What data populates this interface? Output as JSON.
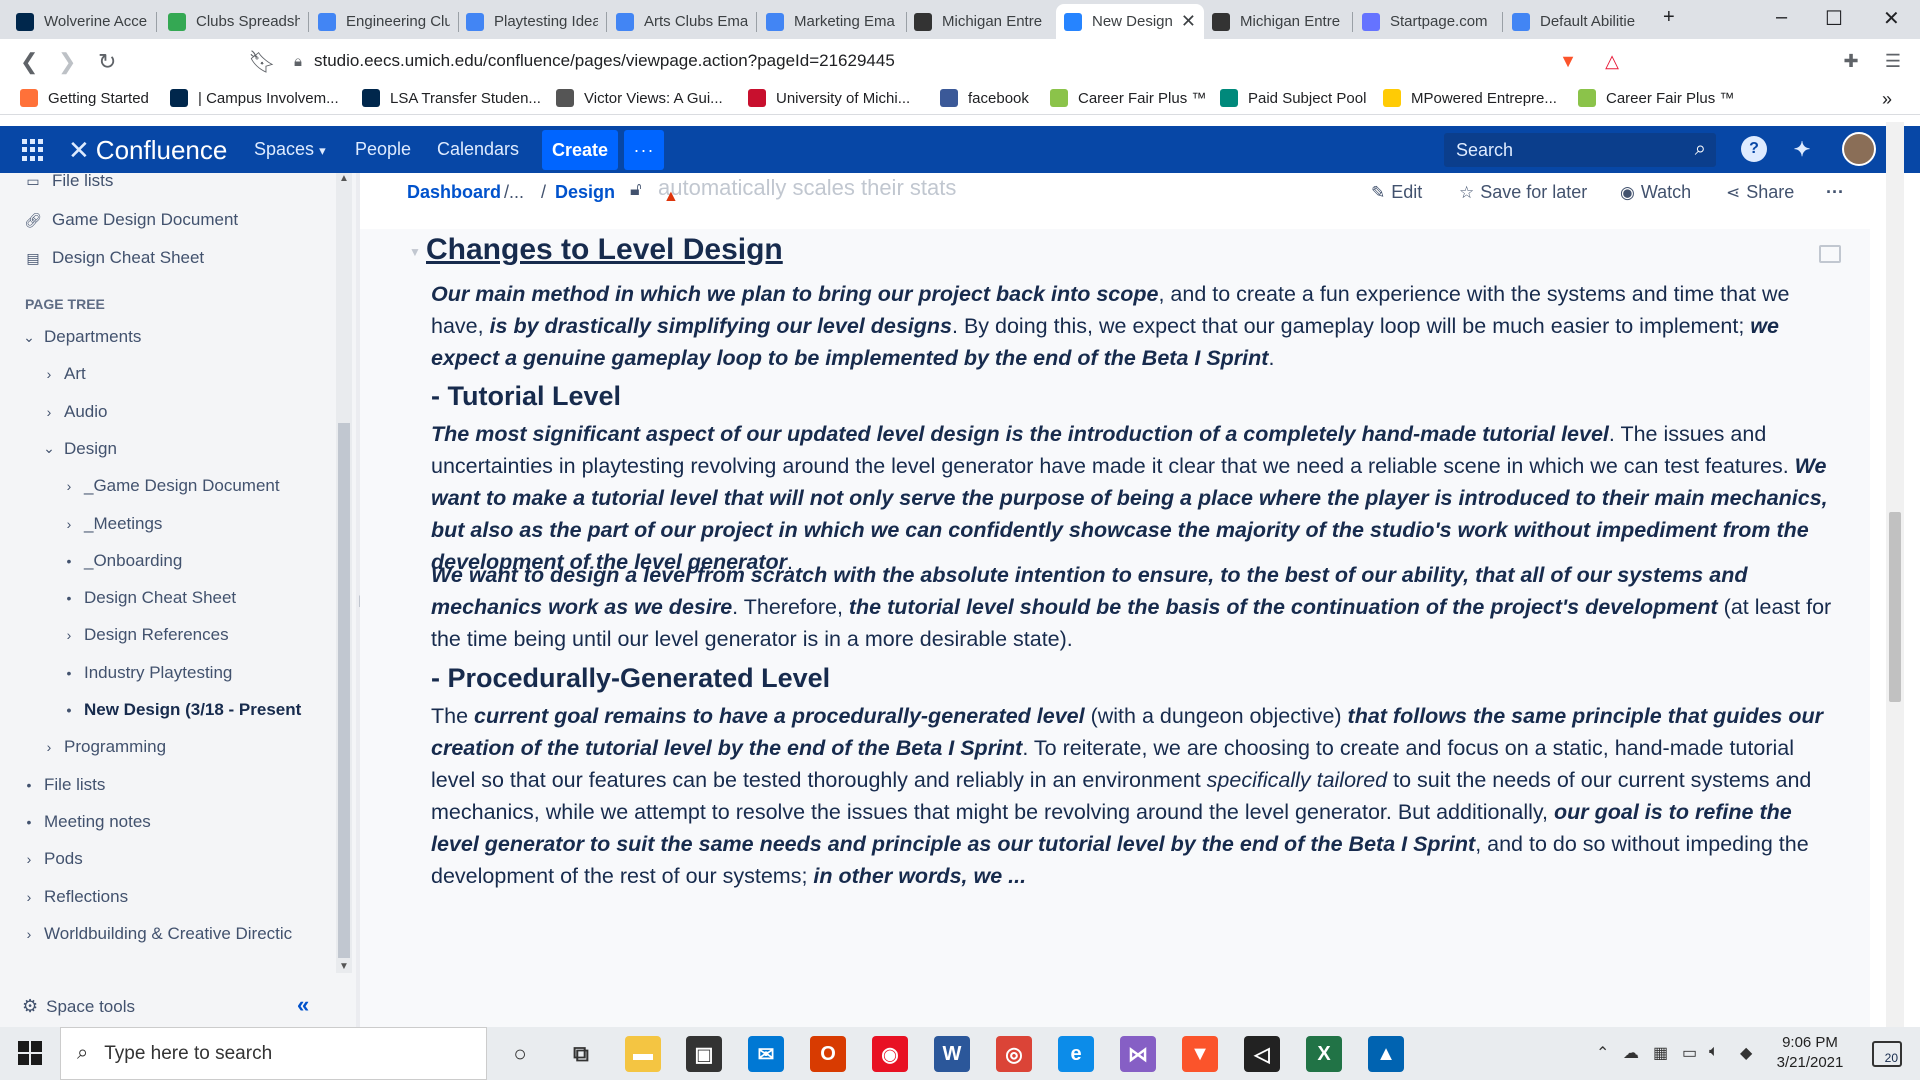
{
  "browser": {
    "tabs": [
      {
        "label": "Wolverine Acce",
        "icon": "michigan-m-icon",
        "color": "#00274c"
      },
      {
        "label": "Clubs Spreadsh",
        "icon": "google-drive-icon",
        "color": "#34a853"
      },
      {
        "label": "Engineering Clu",
        "icon": "google-docs-icon",
        "color": "#4285f4"
      },
      {
        "label": "Playtesting Idea",
        "icon": "google-docs-icon",
        "color": "#4285f4"
      },
      {
        "label": "Arts Clubs Ema",
        "icon": "google-docs-icon",
        "color": "#4285f4"
      },
      {
        "label": "Marketing Ema",
        "icon": "google-docs-icon",
        "color": "#4285f4"
      },
      {
        "label": "Michigan Entre",
        "icon": "mes-icon",
        "color": "#333333"
      },
      {
        "label": "New Design",
        "icon": "confluence-icon",
        "color": "#2684ff"
      },
      {
        "label": "Michigan Entre",
        "icon": "mes-icon",
        "color": "#333333"
      },
      {
        "label": "Startpage.com",
        "icon": "startpage-icon",
        "color": "#6573ff"
      },
      {
        "label": "Default Abilitie",
        "icon": "google-docs-icon",
        "color": "#4285f4"
      }
    ],
    "active_tab_index": 7,
    "url": "studio.eecs.umich.edu/confluence/pages/viewpage.action?pageId=21629445",
    "brave_badge": "2",
    "bookmarks": [
      {
        "label": "Getting Started",
        "icon": "firefox-icon",
        "color": "#ff7139"
      },
      {
        "label": "| Campus Involvem...",
        "icon": "michigan-m-icon",
        "color": "#00274c"
      },
      {
        "label": "LSA Transfer Studen...",
        "icon": "lsa-icon",
        "color": "#00274c"
      },
      {
        "label": "Victor Views: A Gui...",
        "icon": "globe-icon",
        "color": "#555555"
      },
      {
        "label": "University of Michi...",
        "icon": "umich-icon",
        "color": "#c8102e"
      },
      {
        "label": "facebook",
        "icon": "facebook-icon",
        "color": "#3b5998"
      },
      {
        "label": "Career Fair Plus ™",
        "icon": "career-fair-icon",
        "color": "#8bc34a"
      },
      {
        "label": "Paid Subject Pool",
        "icon": "subject-pool-icon",
        "color": "#00897b"
      },
      {
        "label": "MPowered Entrepre...",
        "icon": "mpowered-icon",
        "color": "#ffcb05"
      },
      {
        "label": "Career Fair Plus ™",
        "icon": "career-fair-icon",
        "color": "#8bc34a"
      }
    ]
  },
  "confluence": {
    "brand": "Confluence",
    "nav": [
      "Spaces",
      "People",
      "Calendars"
    ],
    "create_label": "Create",
    "more_label": "···",
    "search_placeholder": "Search",
    "accent": "#0747a6"
  },
  "sidebar": {
    "top_items": [
      {
        "label": "File lists",
        "icon": "folder-icon"
      },
      {
        "label": "Game Design Document",
        "icon": "link-icon"
      },
      {
        "label": "Design Cheat Sheet",
        "icon": "page-icon"
      }
    ],
    "page_tree_heading": "PAGE TREE",
    "tree": [
      {
        "label": "Departments",
        "marker": "⌄",
        "level": 0
      },
      {
        "label": "Art",
        "marker": "›",
        "level": 1
      },
      {
        "label": "Audio",
        "marker": "›",
        "level": 1
      },
      {
        "label": "Design",
        "marker": "⌄",
        "level": 1
      },
      {
        "label": "_Game Design Document",
        "marker": "›",
        "level": 2
      },
      {
        "label": "_Meetings",
        "marker": "›",
        "level": 2
      },
      {
        "label": "_Onboarding",
        "marker": "•",
        "level": 2
      },
      {
        "label": "Design Cheat Sheet",
        "marker": "•",
        "level": 2
      },
      {
        "label": "Design References",
        "marker": "›",
        "level": 2
      },
      {
        "label": "Industry Playtesting",
        "marker": "•",
        "level": 2
      },
      {
        "label": "New Design (3/18 - Present",
        "marker": "•",
        "level": 2,
        "current": true
      },
      {
        "label": "Programming",
        "marker": "›",
        "level": 1
      },
      {
        "label": "File lists",
        "marker": "•",
        "level": 0
      },
      {
        "label": "Meeting notes",
        "marker": "•",
        "level": 0
      },
      {
        "label": "Pods",
        "marker": "›",
        "level": 0
      },
      {
        "label": "Reflections",
        "marker": "›",
        "level": 0
      },
      {
        "label": "Worldbuilding & Creative Directic",
        "marker": "›",
        "level": 0
      }
    ],
    "space_tools": "Space tools",
    "collapse_label": "«"
  },
  "page": {
    "breadcrumb": {
      "root": "Dashboard",
      "sep1": "/...",
      "sep2": "/",
      "current": "Design"
    },
    "faded_text": "automatically scales their stats",
    "actions": {
      "edit": "Edit",
      "save": "Save for later",
      "watch": "Watch",
      "share": "Share",
      "more": "···"
    },
    "heading": "Changes to Level Design",
    "p1": [
      {
        "t": "Our main method in which we plan to bring our project back into scope",
        "s": "bi"
      },
      {
        "t": ", and to create a fun experience with the systems and time that we have, ",
        "s": "n"
      },
      {
        "t": "is by drastically simplifying our level designs",
        "s": "bi"
      },
      {
        "t": ". By doing this, we expect that our gameplay loop will be much easier to implement; ",
        "s": "n"
      },
      {
        "t": "we expect a genuine gameplay loop to be implemented by the end of the Beta I Sprint",
        "s": "bi"
      },
      {
        "t": ".",
        "s": "n"
      }
    ],
    "h_tutorial": "- Tutorial Level",
    "p2": [
      {
        "t": "The most significant aspect of our updated level design is the introduction of a completely hand-made tutorial level",
        "s": "bi"
      },
      {
        "t": ". The issues and uncertainties in playtesting revolving around the level generator have made it clear that we need a reliable scene in which we can test features. ",
        "s": "n"
      },
      {
        "t": "We want to make a tutorial level that will not only serve the purpose of being a place where the player is introduced to their main mechanics, but also as the part of our project in which we can confidently showcase the majority of the studio's work without impediment from the development of the level generator",
        "s": "bi"
      },
      {
        "t": ".",
        "s": "n"
      }
    ],
    "p3": [
      {
        "t": "We want to design a level from scratch with the absolute intention to ensure, to the best of our ability, that all of our systems and mechanics work as we desire",
        "s": "bi"
      },
      {
        "t": ". Therefore, ",
        "s": "n"
      },
      {
        "t": "the tutorial level should be the basis of the continuation of the project's development",
        "s": "bi"
      },
      {
        "t": " (at least for the time being until our level generator is in a more desirable state).",
        "s": "n"
      }
    ],
    "h_procedural": "- Procedurally-Generated Level",
    "p4": [
      {
        "t": "The ",
        "s": "n"
      },
      {
        "t": "current goal remains to have a procedurally-generated level",
        "s": "bi"
      },
      {
        "t": " (with a dungeon objective) ",
        "s": "n"
      },
      {
        "t": "that follows the same principle that guides our creation of the tutorial level by the end of the Beta I Sprint",
        "s": "bi"
      },
      {
        "t": ". To reiterate, we are choosing to create and focus on a static, hand-made tutorial level so that our features can be tested thoroughly and reliably in an environment ",
        "s": "n"
      },
      {
        "t": "specifically tailored",
        "s": "i"
      },
      {
        "t": " to suit the needs of our current systems and mechanics, while we attempt to resolve the issues that might be revolving around the level generator. But additionally, ",
        "s": "n"
      },
      {
        "t": "our goal is to refine the level generator to suit the same needs and principle as our tutorial level by the end of the Beta I Sprint",
        "s": "bi"
      },
      {
        "t": ", and to do so without impeding the development of the rest of our systems; ",
        "s": "n"
      },
      {
        "t": "in other words, we ...",
        "s": "bi"
      }
    ]
  },
  "taskbar": {
    "search_placeholder": "Type here to search",
    "time": "9:06 PM",
    "date": "3/21/2021",
    "notification_count": "20",
    "apps": [
      {
        "icon": "cortana-icon",
        "color": "#333333",
        "glyph": "○"
      },
      {
        "icon": "task-view-icon",
        "color": "#333333",
        "glyph": "⧉"
      },
      {
        "icon": "file-explorer-icon",
        "color": "#f4c542",
        "glyph": "▬"
      },
      {
        "icon": "store-icon",
        "color": "#333333",
        "glyph": "▣"
      },
      {
        "icon": "mail-icon",
        "color": "#0078d4",
        "glyph": "✉"
      },
      {
        "icon": "office-icon",
        "color": "#d83b01",
        "glyph": "O"
      },
      {
        "icon": "webcam-icon",
        "color": "#e81123",
        "glyph": "◉"
      },
      {
        "icon": "word-icon",
        "color": "#2b579a",
        "glyph": "W"
      },
      {
        "icon": "chrome-icon",
        "color": "#db4437",
        "glyph": "◎"
      },
      {
        "icon": "edge-icon",
        "color": "#0c8ce9",
        "glyph": "e"
      },
      {
        "icon": "visual-studio-icon",
        "color": "#865fc5",
        "glyph": "⋈"
      },
      {
        "icon": "brave-icon",
        "color": "#fb542b",
        "glyph": "▼"
      },
      {
        "icon": "unity-icon",
        "color": "#222222",
        "glyph": "◁"
      },
      {
        "icon": "excel-icon",
        "color": "#217346",
        "glyph": "X"
      },
      {
        "icon": "photos-icon",
        "color": "#0063b1",
        "glyph": "▲"
      }
    ]
  }
}
